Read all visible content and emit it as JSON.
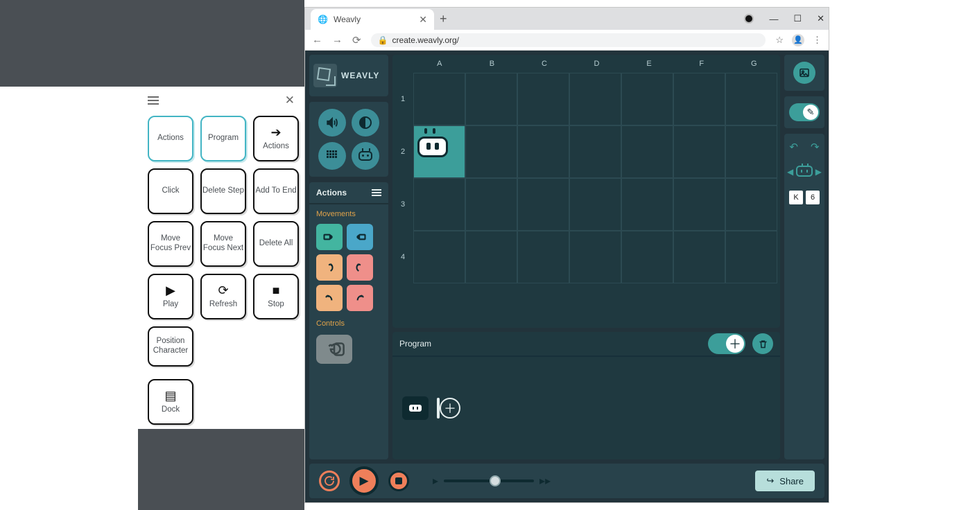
{
  "browser": {
    "tab_title": "Weavly",
    "url": "create.weavly.org/"
  },
  "logo": "WEAVLY",
  "kb_panel": {
    "tabs": {
      "actions": "Actions",
      "program": "Program"
    },
    "arrow_actions": "Actions",
    "buttons": {
      "click": "Click",
      "delete_step": "Delete Step",
      "add_end": "Add To End",
      "focus_prev": "Move Focus Prev",
      "focus_next": "Move Focus Next",
      "delete_all": "Delete All",
      "play": "Play",
      "refresh": "Refresh",
      "stop": "Stop",
      "pos_char": "Position Character",
      "dock": "Dock"
    }
  },
  "actions_panel": {
    "title": "Actions",
    "movements": "Movements",
    "controls": "Controls"
  },
  "grid": {
    "cols": [
      "A",
      "B",
      "C",
      "D",
      "E",
      "F",
      "G"
    ],
    "rows": [
      "1",
      "2",
      "3",
      "4"
    ]
  },
  "program": {
    "title": "Program"
  },
  "right": {
    "coord_col": "K",
    "coord_row": "6"
  },
  "footer": {
    "share": "Share"
  }
}
